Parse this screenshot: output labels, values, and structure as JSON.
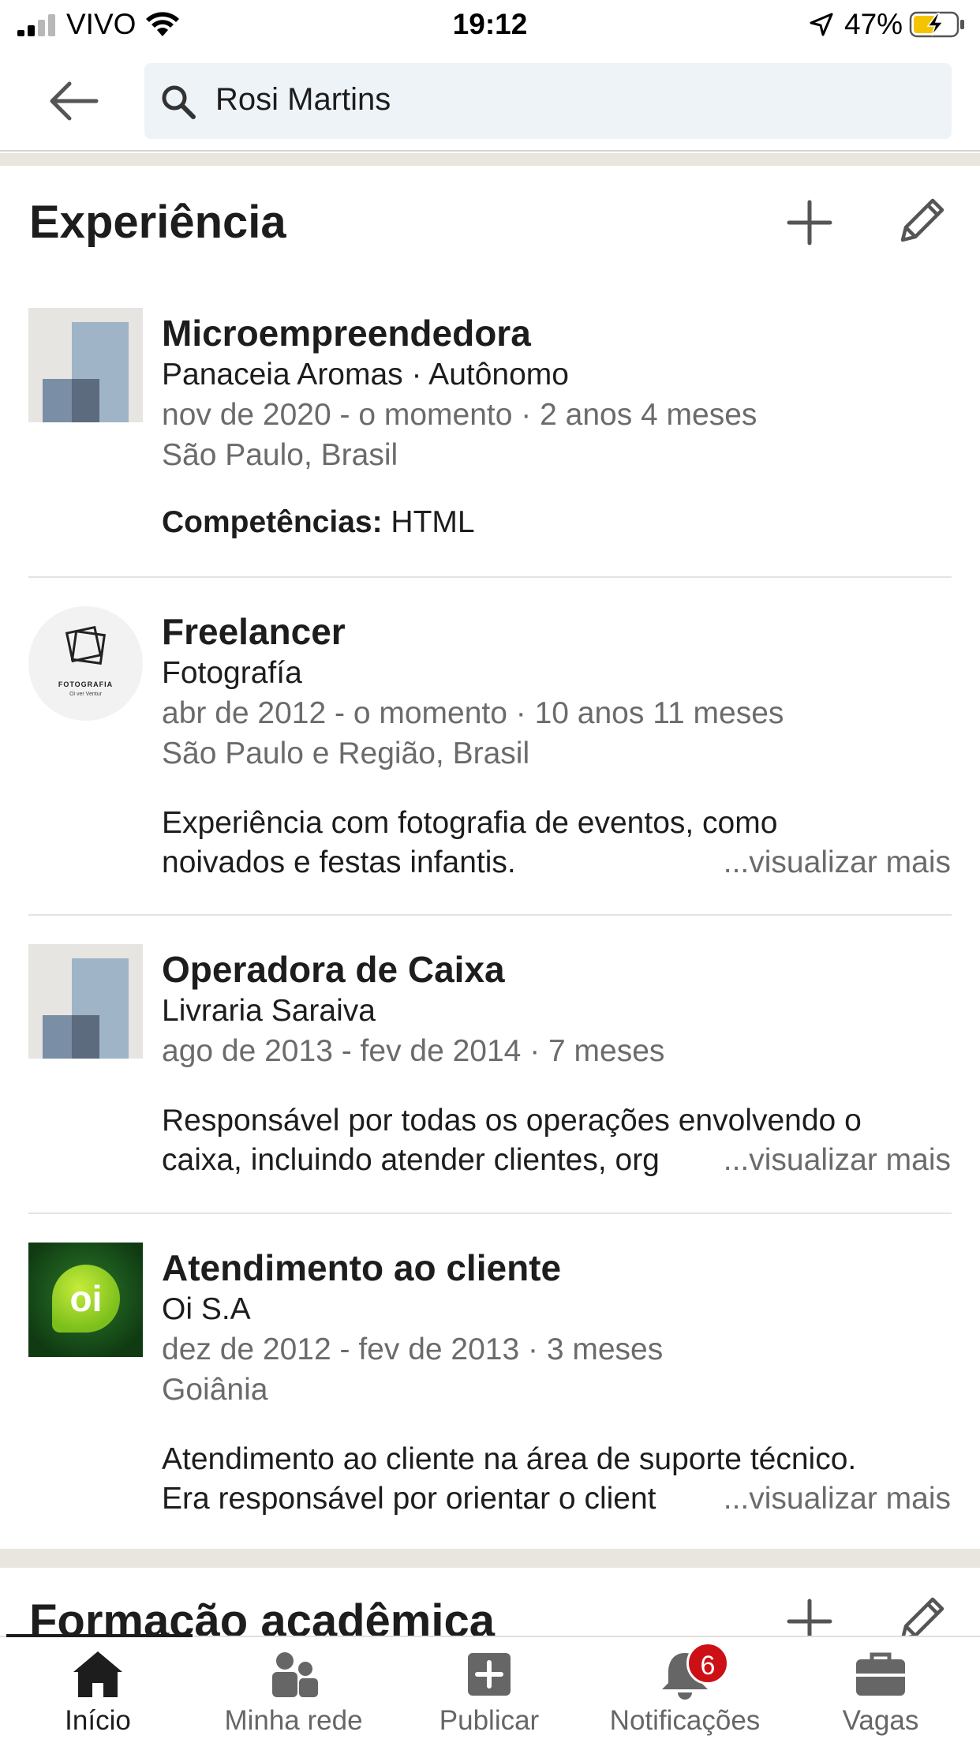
{
  "status_bar": {
    "carrier": "VIVO",
    "time": "19:12",
    "battery_percent": "47%"
  },
  "search": {
    "query": "Rosi Martins"
  },
  "experience": {
    "title": "Experiência",
    "entries": [
      {
        "role": "Microempreendedora",
        "company": "Panaceia Aromas · Autônomo",
        "dates": "nov de 2020 - o momento · 2 anos 4 meses",
        "location": "São Paulo, Brasil",
        "skills_label": "Competências:",
        "skills": " HTML"
      },
      {
        "role": "Freelancer",
        "company": "Fotografía",
        "dates": "abr de 2012 - o momento · 10 anos 11 meses",
        "location": "São Paulo e Região, Brasil",
        "logo_text": "Fotografia",
        "logo_subtext": "Oi ver Ventur",
        "desc_line1": "Experiência com fotografia de eventos, como",
        "desc_line2": "noivados e festas infantis.",
        "see_more": "...visualizar mais"
      },
      {
        "role": "Operadora de Caixa",
        "company": "Livraria Saraiva",
        "dates": "ago de 2013 - fev de 2014 · 7 meses",
        "desc_line1": "Responsável por todas os operações envolvendo o",
        "desc_line2": "caixa, incluindo atender clientes, org",
        "see_more": "...visualizar mais"
      },
      {
        "role": "Atendimento ao cliente",
        "company": "Oi S.A",
        "dates": "dez de 2012 - fev de 2013 · 3 meses",
        "location": "Goiânia",
        "logo_text": "oi",
        "desc_line1": "Atendimento ao cliente na área de suporte técnico.",
        "desc_line2": "Era responsável por orientar o client",
        "see_more": "...visualizar mais"
      }
    ]
  },
  "education": {
    "title": "Formação acadêmica"
  },
  "bottom_nav": {
    "items": [
      {
        "label": "Início",
        "icon": "home-icon"
      },
      {
        "label": "Minha rede",
        "icon": "network-icon"
      },
      {
        "label": "Publicar",
        "icon": "post-icon"
      },
      {
        "label": "Notificações",
        "icon": "bell-icon",
        "badge": "6"
      },
      {
        "label": "Vagas",
        "icon": "briefcase-icon"
      }
    ]
  },
  "colors": {
    "badge": "#cc1016",
    "search_bg": "#eef3f8",
    "section_band": "#e9e5df",
    "muted_text": "#6b6b6b"
  }
}
